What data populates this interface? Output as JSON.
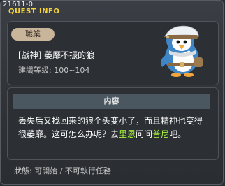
{
  "window": {
    "id_tag": "21611-0",
    "title": "QUEST INFO"
  },
  "quest": {
    "category_badge": "職業",
    "name": "[战神] 萎靡不振的狼",
    "level_requirement": "建議等级: 100~104"
  },
  "details": {
    "header": "内容",
    "text_part1": "丢失后又找回来的狼个头变小了，而且精神也变得很萎靡。这可怎么办呢？去",
    "npc1": "里恩",
    "text_part2": "问问",
    "npc2": "普尼",
    "text_part3": "吧。"
  },
  "status_line": "狀態: 可開始 / 不可執行任務",
  "colors": {
    "title": "#f6d53a",
    "npc_highlight": "#a7f83c",
    "badge_bg": "#c9b59a",
    "header_bar": "#4a5761"
  },
  "icons": {
    "mascot": "penguin-mascot-icon"
  }
}
